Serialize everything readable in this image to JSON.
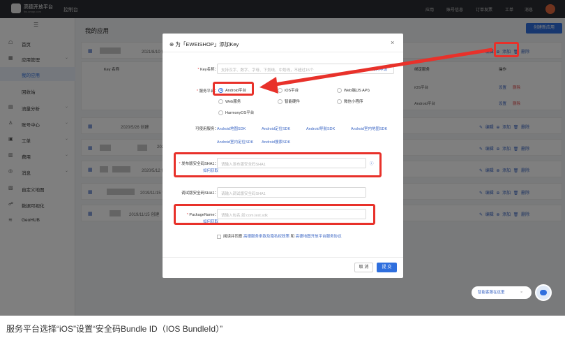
{
  "topbar": {
    "brand": "高德开放平台",
    "brand_sub": "lbs.amap.com",
    "console": "控制台",
    "nav": [
      "应用",
      "账号信息",
      "订单发票",
      "工单",
      "消息"
    ]
  },
  "sidebar": {
    "items": [
      {
        "icon": "☖",
        "label": "首页",
        "arrow": ""
      },
      {
        "icon": "▦",
        "label": "应用管理",
        "arrow": "⌄"
      },
      {
        "icon": "",
        "label": "我的应用",
        "arrow": ""
      },
      {
        "icon": "",
        "label": "回收站",
        "arrow": ""
      },
      {
        "icon": "▤",
        "label": "流量分析",
        "arrow": "⌄"
      },
      {
        "icon": "♙",
        "label": "账号中心",
        "arrow": "⌄"
      },
      {
        "icon": "▣",
        "label": "工单",
        "arrow": "⌄"
      },
      {
        "icon": "▥",
        "label": "费用",
        "arrow": "⌄"
      },
      {
        "icon": "◎",
        "label": "消息",
        "arrow": "⌄"
      },
      {
        "icon": "▧",
        "label": "自定义地图",
        "arrow": ""
      },
      {
        "icon": "☍",
        "label": "数据可视化",
        "arrow": ""
      },
      {
        "icon": "≋",
        "label": "GeoHUB",
        "arrow": ""
      }
    ]
  },
  "main": {
    "title": "我的应用",
    "create_button": "创建新应用",
    "cards": [
      {
        "date": "2021/8/10 创"
      },
      {
        "date": "2020/5/26 创建"
      },
      {
        "date": "2020"
      },
      {
        "date": "2020/5/12 创"
      },
      {
        "date": "2019/11/15 创"
      },
      {
        "date": "2019/11/15 创建"
      },
      {
        "date": "2019/11/15 创"
      }
    ],
    "card_ops": [
      "编辑",
      "添加",
      "删除"
    ],
    "subtable": {
      "headers": [
        "Key 名称",
        "绑定服务",
        "操作"
      ],
      "rows": [
        {
          "service": "iOS平台",
          "op1": "设置",
          "op2": "删除"
        },
        {
          "service": "Android平台",
          "op1": "设置",
          "op2": "删除"
        }
      ]
    }
  },
  "modal": {
    "title": "为「EWEISHOP」添加Key",
    "close": "×",
    "key_name": {
      "label": "Key名称：",
      "placeholder": "支持汉字、数字、字母、下划线、中划线，不超过15个",
      "hint": "如何申请"
    },
    "platform_label": "服务平台：",
    "platforms": [
      {
        "label": "Android平台",
        "checked": true
      },
      {
        "label": "iOS平台",
        "checked": false
      },
      {
        "label": "Web端(JS API)",
        "checked": false
      },
      {
        "label": "Web服务",
        "checked": false
      },
      {
        "label": "智能硬件",
        "checked": false
      },
      {
        "label": "微信小程序",
        "checked": false
      },
      {
        "label": "HarmonyOS平台",
        "checked": false
      }
    ],
    "services_label": "可使用服务：",
    "services": [
      "Android地图SDK",
      "Android定位SDK",
      "Android导航SDK",
      "Android室内地图SDK",
      "Android室内定位SDK",
      "Android搜索SDK"
    ],
    "sha1_release": {
      "label": "发布版安全码SHA1：",
      "placeholder": "请输入发布版安全码SHA1",
      "help": "如何获取"
    },
    "sha1_debug": {
      "label": "调试版安全码SHA1：",
      "placeholder": "请输入调试版安全码SHA1"
    },
    "package_name": {
      "label": "PackageName：",
      "placeholder": "请输入包名,如:com.test.sdk",
      "help": "如何获取"
    },
    "agreement": {
      "prefix": "阅读并同意",
      "link1": "高德服务条款及隐私权政策",
      "and": "和",
      "link2": "高德地图开放平台服务协议"
    },
    "cancel": "取 消",
    "submit": "提 交"
  },
  "help": {
    "text": "智能客服在这里",
    "close": "×"
  },
  "caption": "服务平台选择“iOS”设置“安全码Bundle ID（IOS BundleId）”",
  "colors": {
    "accent": "#2f6fde",
    "highlight": "#e8312a",
    "topbar": "#2b2d33"
  }
}
